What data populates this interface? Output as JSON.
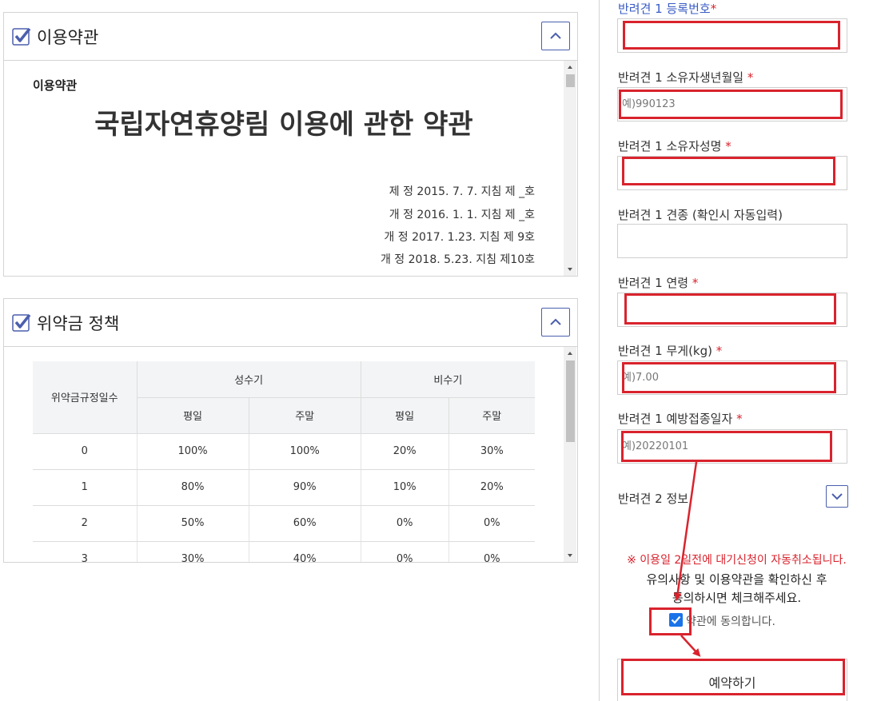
{
  "terms": {
    "title": "이용약관",
    "small_title": "이용약관",
    "doc_title": "국립자연휴양림 이용에 관한 약관",
    "revisions": [
      "제 정 2015. 7. 7. 지침 제 _호",
      "개 정 2016. 1. 1. 지침 제 _호",
      "개 정 2017. 1.23. 지침 제 9호",
      "개 정 2018. 5.23. 지침 제10호"
    ]
  },
  "penalty": {
    "title": "위약금 정책",
    "col_days": "위약금규정일수",
    "col_peak": "성수기",
    "col_offpeak": "비수기",
    "col_weekday": "평일",
    "col_weekend": "주말",
    "rows": [
      [
        "0",
        "100%",
        "100%",
        "20%",
        "30%"
      ],
      [
        "1",
        "80%",
        "90%",
        "10%",
        "20%"
      ],
      [
        "2",
        "50%",
        "60%",
        "0%",
        "0%"
      ],
      [
        "3",
        "30%",
        "40%",
        "0%",
        "0%"
      ]
    ]
  },
  "form": {
    "reg_label": "반려견 1 등록번호",
    "birth_label": "반려견 1 소유자생년월일 ",
    "birth_placeholder": "예)990123",
    "owner_label": "반려견 1 소유자성명 ",
    "breed_label": "반려견 1 견종 (확인시 자동입력)",
    "age_label": "반려견 1 연령 ",
    "weight_label": "반려견 1 무게(kg) ",
    "weight_placeholder": "예)7.00",
    "vacc_label": "반려견 1 예방접종일자 ",
    "vacc_placeholder": "예)20220101",
    "dog2_label": "반려견 2 정보",
    "required_mark": "*",
    "notice_red": "※ 이용일 2일전에 대기신청이 자동취소됩니다.",
    "notice_line1": "유의사항 및 이용약관을 확인하신 후",
    "notice_line2": "동의하시면 체크해주세요.",
    "agree_label": "약관에 동의합니다.",
    "reserve_label": "예약하기"
  },
  "colors": {
    "accent": "#4b5fae",
    "highlight_red": "#d9232d",
    "checkbox_blue": "#1a73e8"
  }
}
